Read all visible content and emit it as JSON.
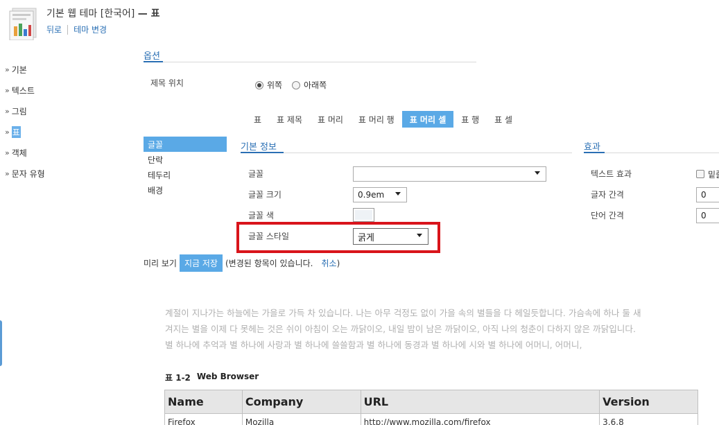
{
  "header": {
    "title": "기본 웹 테마 [한국어]",
    "title_suffix": "— 표",
    "back_link": "뒤로",
    "change_theme_link": "테마 변경"
  },
  "sidebar": {
    "items": [
      {
        "label": "기본",
        "active": false
      },
      {
        "label": "텍스트",
        "active": false
      },
      {
        "label": "그림",
        "active": false
      },
      {
        "label": "표",
        "active": true
      },
      {
        "label": "객체",
        "active": false
      },
      {
        "label": "문자 유형",
        "active": false
      }
    ]
  },
  "options": {
    "section_title": "옵션",
    "title_position_label": "제목 위치",
    "radio_top": "위쪽",
    "radio_bottom": "아래쪽",
    "selected": "위쪽"
  },
  "tabs": [
    {
      "label": "표",
      "active": false
    },
    {
      "label": "표 제목",
      "active": false
    },
    {
      "label": "표 머리",
      "active": false
    },
    {
      "label": "표 머리 행",
      "active": false
    },
    {
      "label": "표 머리 셀",
      "active": true
    },
    {
      "label": "표 행",
      "active": false
    },
    {
      "label": "표 셀",
      "active": false
    }
  ],
  "subnav": {
    "items": [
      {
        "label": "글꼴",
        "active": true
      },
      {
        "label": "단락",
        "active": false
      },
      {
        "label": "테두리",
        "active": false
      },
      {
        "label": "배경",
        "active": false
      }
    ]
  },
  "basic_info": {
    "section_title": "기본 정보",
    "font_label": "글꼴",
    "font_value": "",
    "font_size_label": "글꼴 크기",
    "font_size_value": "0.9em",
    "font_color_label": "글꼴 색",
    "font_color_value": "#eef2f6",
    "font_style_label": "글꼴 스타일",
    "font_style_value": "굵게"
  },
  "effects": {
    "section_title": "효과",
    "text_effect_label": "텍스트 효과",
    "text_effect_checkbox_label": "밑줄",
    "letter_spacing_label": "글자 간격",
    "letter_spacing_value": "0",
    "word_spacing_label": "단어 간격",
    "word_spacing_value": "0"
  },
  "preview_bar": {
    "preview_label": "미리 보기",
    "save_button": "지금 저장",
    "changed_notice": "(변경된 항목이 있습니다.",
    "cancel_link": "취소",
    "close_paren": ")"
  },
  "sample": {
    "paragraph_lines": [
      "계절이 지나가는 하늘에는 가을로 가득 차 있습니다. 나는 아무 걱정도 없이 가을 속의 별들을 다 헤일듯합니다. 가슴속에 하나 둘 새",
      "겨지는 별을 이제 다 못헤는 것은 쉬이 아침이 오는 까닭이오, 내일 밤이 남은 까닭이오, 아직 나의 청춘이 다하지 않은 까닭입니다.",
      "별 하나에 추억과 별 하나에 사랑과 별 하나에 쓸쓸함과 별 하나에 동경과 별 하나에 시와 별 하나에 어머니, 어머니,"
    ],
    "table_caption_num": "표 1-2",
    "table_caption_title": "Web Browser",
    "table_headers": [
      "Name",
      "Company",
      "URL",
      "Version"
    ],
    "table_rows": [
      [
        "Firefox",
        "Mozilla",
        "http://www.mozilla.com/firefox",
        "3.6.8"
      ]
    ]
  },
  "colors": {
    "accent": "#5aa9e6",
    "link": "#2a6fb4",
    "highlight_border": "#d9141b"
  }
}
